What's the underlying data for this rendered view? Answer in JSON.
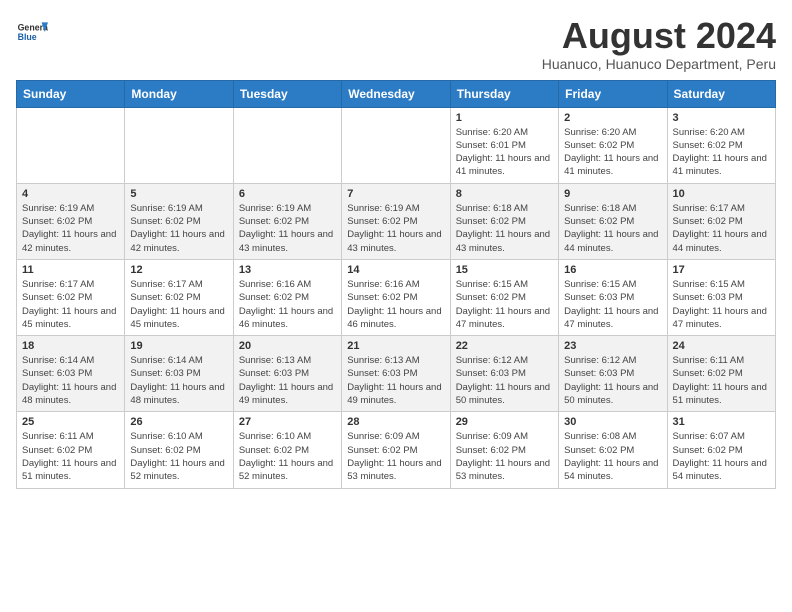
{
  "header": {
    "logo_line1": "General",
    "logo_line2": "Blue",
    "month_year": "August 2024",
    "location": "Huanuco, Huanuco Department, Peru"
  },
  "weekdays": [
    "Sunday",
    "Monday",
    "Tuesday",
    "Wednesday",
    "Thursday",
    "Friday",
    "Saturday"
  ],
  "weeks": [
    [
      {
        "day": "",
        "info": ""
      },
      {
        "day": "",
        "info": ""
      },
      {
        "day": "",
        "info": ""
      },
      {
        "day": "",
        "info": ""
      },
      {
        "day": "1",
        "info": "Sunrise: 6:20 AM\nSunset: 6:01 PM\nDaylight: 11 hours and 41 minutes."
      },
      {
        "day": "2",
        "info": "Sunrise: 6:20 AM\nSunset: 6:02 PM\nDaylight: 11 hours and 41 minutes."
      },
      {
        "day": "3",
        "info": "Sunrise: 6:20 AM\nSunset: 6:02 PM\nDaylight: 11 hours and 41 minutes."
      }
    ],
    [
      {
        "day": "4",
        "info": "Sunrise: 6:19 AM\nSunset: 6:02 PM\nDaylight: 11 hours and 42 minutes."
      },
      {
        "day": "5",
        "info": "Sunrise: 6:19 AM\nSunset: 6:02 PM\nDaylight: 11 hours and 42 minutes."
      },
      {
        "day": "6",
        "info": "Sunrise: 6:19 AM\nSunset: 6:02 PM\nDaylight: 11 hours and 43 minutes."
      },
      {
        "day": "7",
        "info": "Sunrise: 6:19 AM\nSunset: 6:02 PM\nDaylight: 11 hours and 43 minutes."
      },
      {
        "day": "8",
        "info": "Sunrise: 6:18 AM\nSunset: 6:02 PM\nDaylight: 11 hours and 43 minutes."
      },
      {
        "day": "9",
        "info": "Sunrise: 6:18 AM\nSunset: 6:02 PM\nDaylight: 11 hours and 44 minutes."
      },
      {
        "day": "10",
        "info": "Sunrise: 6:17 AM\nSunset: 6:02 PM\nDaylight: 11 hours and 44 minutes."
      }
    ],
    [
      {
        "day": "11",
        "info": "Sunrise: 6:17 AM\nSunset: 6:02 PM\nDaylight: 11 hours and 45 minutes."
      },
      {
        "day": "12",
        "info": "Sunrise: 6:17 AM\nSunset: 6:02 PM\nDaylight: 11 hours and 45 minutes."
      },
      {
        "day": "13",
        "info": "Sunrise: 6:16 AM\nSunset: 6:02 PM\nDaylight: 11 hours and 46 minutes."
      },
      {
        "day": "14",
        "info": "Sunrise: 6:16 AM\nSunset: 6:02 PM\nDaylight: 11 hours and 46 minutes."
      },
      {
        "day": "15",
        "info": "Sunrise: 6:15 AM\nSunset: 6:02 PM\nDaylight: 11 hours and 47 minutes."
      },
      {
        "day": "16",
        "info": "Sunrise: 6:15 AM\nSunset: 6:03 PM\nDaylight: 11 hours and 47 minutes."
      },
      {
        "day": "17",
        "info": "Sunrise: 6:15 AM\nSunset: 6:03 PM\nDaylight: 11 hours and 47 minutes."
      }
    ],
    [
      {
        "day": "18",
        "info": "Sunrise: 6:14 AM\nSunset: 6:03 PM\nDaylight: 11 hours and 48 minutes."
      },
      {
        "day": "19",
        "info": "Sunrise: 6:14 AM\nSunset: 6:03 PM\nDaylight: 11 hours and 48 minutes."
      },
      {
        "day": "20",
        "info": "Sunrise: 6:13 AM\nSunset: 6:03 PM\nDaylight: 11 hours and 49 minutes."
      },
      {
        "day": "21",
        "info": "Sunrise: 6:13 AM\nSunset: 6:03 PM\nDaylight: 11 hours and 49 minutes."
      },
      {
        "day": "22",
        "info": "Sunrise: 6:12 AM\nSunset: 6:03 PM\nDaylight: 11 hours and 50 minutes."
      },
      {
        "day": "23",
        "info": "Sunrise: 6:12 AM\nSunset: 6:03 PM\nDaylight: 11 hours and 50 minutes."
      },
      {
        "day": "24",
        "info": "Sunrise: 6:11 AM\nSunset: 6:02 PM\nDaylight: 11 hours and 51 minutes."
      }
    ],
    [
      {
        "day": "25",
        "info": "Sunrise: 6:11 AM\nSunset: 6:02 PM\nDaylight: 11 hours and 51 minutes."
      },
      {
        "day": "26",
        "info": "Sunrise: 6:10 AM\nSunset: 6:02 PM\nDaylight: 11 hours and 52 minutes."
      },
      {
        "day": "27",
        "info": "Sunrise: 6:10 AM\nSunset: 6:02 PM\nDaylight: 11 hours and 52 minutes."
      },
      {
        "day": "28",
        "info": "Sunrise: 6:09 AM\nSunset: 6:02 PM\nDaylight: 11 hours and 53 minutes."
      },
      {
        "day": "29",
        "info": "Sunrise: 6:09 AM\nSunset: 6:02 PM\nDaylight: 11 hours and 53 minutes."
      },
      {
        "day": "30",
        "info": "Sunrise: 6:08 AM\nSunset: 6:02 PM\nDaylight: 11 hours and 54 minutes."
      },
      {
        "day": "31",
        "info": "Sunrise: 6:07 AM\nSunset: 6:02 PM\nDaylight: 11 hours and 54 minutes."
      }
    ]
  ]
}
